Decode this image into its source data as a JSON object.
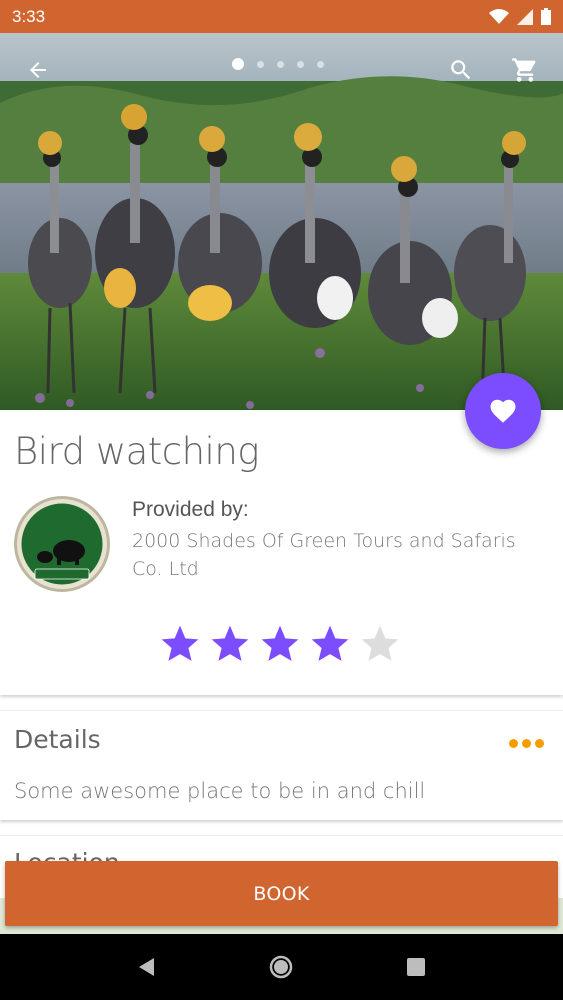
{
  "status_bar": {
    "time": "3:33"
  },
  "hero": {
    "carousel_total": 5,
    "carousel_active_index": 0
  },
  "colors": {
    "accent": "#D0652F",
    "fab": "#7C4DFF",
    "star_filled": "#7C4DFF",
    "star_empty": "#DDDDDD",
    "more_dots": "#F59C00"
  },
  "icons": {
    "back": "arrow-back-icon",
    "search": "search-icon",
    "cart": "cart-icon",
    "favorite": "heart-icon"
  },
  "activity": {
    "title": "Bird watching",
    "provided_by_label": "Provided by:",
    "provider_name": "2000 Shades Of Green Tours and Safaris Co. Ltd",
    "rating": 4,
    "rating_max": 5
  },
  "details": {
    "title": "Details",
    "text": "Some awesome place to be in and chill"
  },
  "location": {
    "title": "Location"
  },
  "book_button": {
    "label": "BOOK"
  }
}
